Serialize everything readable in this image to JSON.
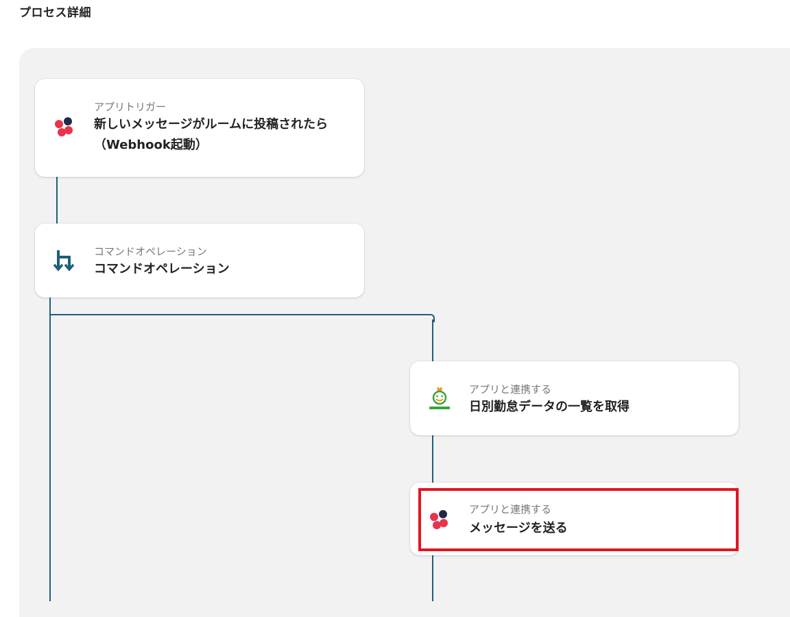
{
  "page": {
    "title": "プロセス詳細"
  },
  "steps": [
    {
      "kicker": "アプリトリガー",
      "heading_line1": "新しいメッセージがルームに投稿されたら",
      "heading_line2": "（Webhook起動）",
      "icon": "chatwork-icon"
    },
    {
      "kicker": "コマンドオペレーション",
      "heading": "コマンドオペレーション",
      "icon": "branch-command-icon"
    },
    {
      "kicker": "アプリと連携する",
      "heading": "日別勤怠データの一覧を取得",
      "icon": "king-of-time-icon"
    },
    {
      "kicker": "アプリと連携する",
      "heading": "メッセージを送る",
      "icon": "chatwork-icon"
    }
  ],
  "colors": {
    "connector": "#1f5f7a",
    "highlight": "#e0161f",
    "chat_red": "#e8334a",
    "chat_dark": "#1d2b4a",
    "kot_green": "#3aa33a",
    "kot_orange": "#f29a1d"
  }
}
